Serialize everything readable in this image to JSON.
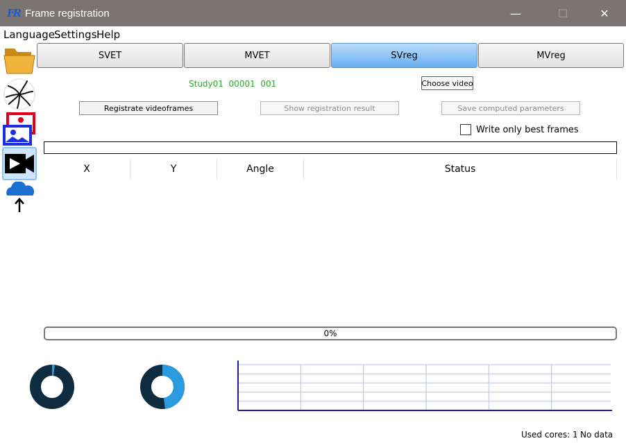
{
  "window": {
    "title": "Frame registration",
    "app_icon": "FR",
    "minimize": "—",
    "maximize": "☐",
    "close": "✕"
  },
  "menu": {
    "items": [
      "Language",
      "Settings",
      "Help"
    ]
  },
  "sidebar": {
    "icons": [
      "folder-icon",
      "vessel-icon",
      "image-stack-icon",
      "video-icon",
      "cloud-upload-icon"
    ]
  },
  "tabs": [
    {
      "label": "SVET",
      "active": false
    },
    {
      "label": "MVET",
      "active": false
    },
    {
      "label": "SVreg",
      "active": true
    },
    {
      "label": "MVreg",
      "active": false
    }
  ],
  "study_label": "Study01  00001  001",
  "buttons": {
    "choose_video": "Choose video",
    "registrate": "Registrate videoframes",
    "show_result": "Show registration result",
    "save_params": "Save computed parameters"
  },
  "checkbox": {
    "label": "Write only best frames",
    "checked": false
  },
  "table": {
    "columns": [
      "X",
      "Y",
      "Angle",
      "Status"
    ],
    "rows": []
  },
  "progress": {
    "label": "0%",
    "value": 0
  },
  "donuts": [
    {
      "value": 0.02,
      "color_main": "#0f2b3f",
      "color_fill": "#2b9be0"
    },
    {
      "value": 0.48,
      "color_main": "#0f2b3f",
      "color_fill": "#2b9be0"
    }
  ],
  "chart_data": {
    "type": "line",
    "series": [],
    "grid": true,
    "title": "",
    "xlabel": "",
    "ylabel": ""
  },
  "status": {
    "cores": "Used cores: 1",
    "data": "No data"
  },
  "colors": {
    "accent": "#6aaff0",
    "study_text": "#2ea82e",
    "titlebar": "#7a7572"
  }
}
